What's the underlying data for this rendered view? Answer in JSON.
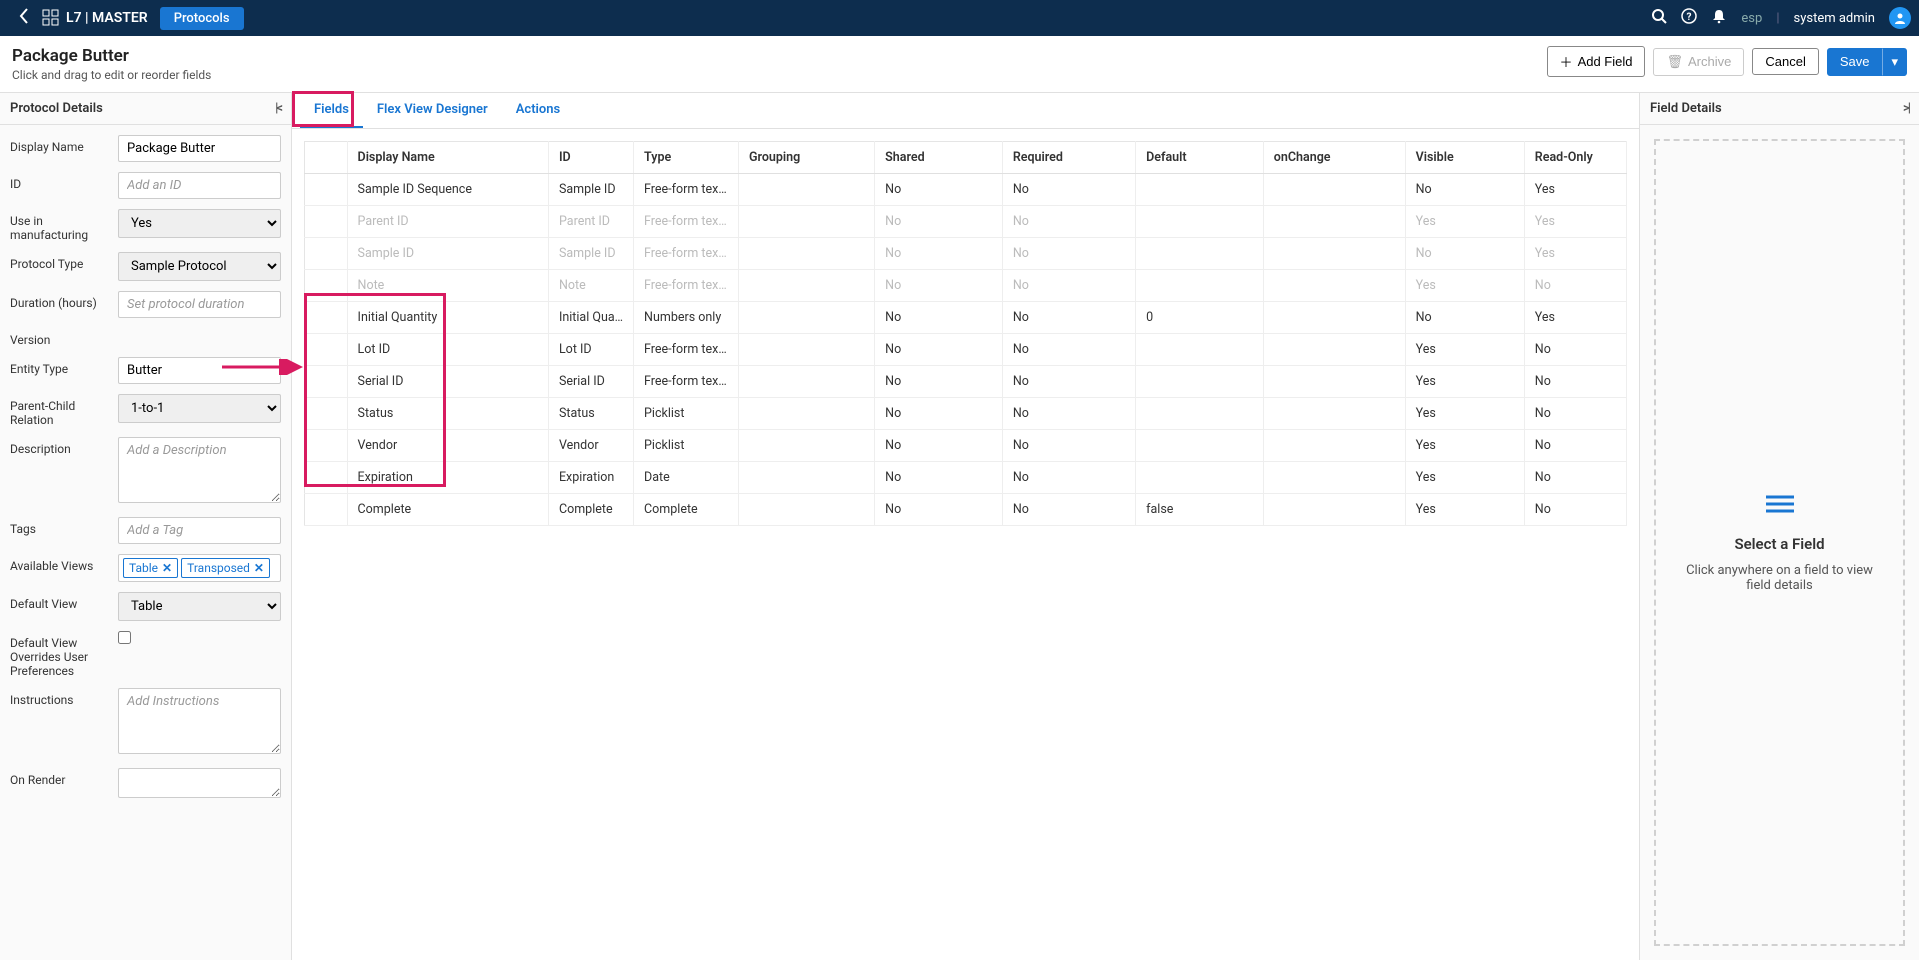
{
  "topnav": {
    "brand": "L7 | MASTER",
    "pill": "Protocols",
    "esp_label": "esp",
    "username": "system admin"
  },
  "header": {
    "title": "Package Butter",
    "subtitle": "Click and drag to edit or reorder fields",
    "add_field": "Add Field",
    "archive": "Archive",
    "cancel": "Cancel",
    "save": "Save"
  },
  "left": {
    "panel_title": "Protocol Details",
    "labels": {
      "display_name": "Display Name",
      "id": "ID",
      "use_mfg": "Use in manufacturing",
      "protocol_type": "Protocol Type",
      "duration": "Duration (hours)",
      "version": "Version",
      "entity_type": "Entity Type",
      "parent_child": "Parent-Child Relation",
      "description": "Description",
      "tags": "Tags",
      "available_views": "Available Views",
      "default_view": "Default View",
      "default_override": "Default View Overrides User Preferences",
      "instructions": "Instructions",
      "on_render": "On Render"
    },
    "values": {
      "display_name": "Package Butter",
      "id_placeholder": "Add an ID",
      "use_mfg": "Yes",
      "protocol_type": "Sample Protocol",
      "duration_placeholder": "Set protocol duration",
      "entity_type": "Butter",
      "parent_child": "1-to-1",
      "description_placeholder": "Add a Description",
      "tags_placeholder": "Add a Tag",
      "chips": [
        "Table",
        "Transposed"
      ],
      "default_view": "Table",
      "instructions_placeholder": "Add Instructions"
    }
  },
  "tabs": {
    "fields": "Fields",
    "flex": "Flex View Designer",
    "actions": "Actions"
  },
  "table": {
    "headers": [
      "",
      "Display Name",
      "ID",
      "Type",
      "Grouping",
      "Shared",
      "Required",
      "Default",
      "onChange",
      "Visible",
      "Read-Only"
    ],
    "rows": [
      {
        "dim": false,
        "name": "Sample ID Sequence",
        "id": "Sample ID",
        "type": "Free-form text entry",
        "grp": "",
        "shared": "No",
        "req": "No",
        "def": "",
        "chg": "",
        "vis": "No",
        "ro": "Yes"
      },
      {
        "dim": true,
        "name": "Parent ID",
        "id": "Parent ID",
        "type": "Free-form text entry",
        "grp": "",
        "shared": "No",
        "req": "No",
        "def": "",
        "chg": "",
        "vis": "Yes",
        "ro": "Yes"
      },
      {
        "dim": true,
        "name": "Sample ID",
        "id": "Sample ID",
        "type": "Free-form text entry",
        "grp": "",
        "shared": "No",
        "req": "No",
        "def": "",
        "chg": "",
        "vis": "No",
        "ro": "Yes"
      },
      {
        "dim": true,
        "name": "Note",
        "id": "Note",
        "type": "Free-form text entry",
        "grp": "",
        "shared": "No",
        "req": "No",
        "def": "",
        "chg": "",
        "vis": "Yes",
        "ro": "No"
      },
      {
        "dim": false,
        "name": "Initial Quantity",
        "id": "Initial Quantity",
        "type": "Numbers only",
        "grp": "",
        "shared": "No",
        "req": "No",
        "def": "0",
        "chg": "",
        "vis": "No",
        "ro": "Yes"
      },
      {
        "dim": false,
        "name": "Lot ID",
        "id": "Lot ID",
        "type": "Free-form text entry",
        "grp": "",
        "shared": "No",
        "req": "No",
        "def": "",
        "chg": "",
        "vis": "Yes",
        "ro": "No"
      },
      {
        "dim": false,
        "name": "Serial ID",
        "id": "Serial ID",
        "type": "Free-form text entry",
        "grp": "",
        "shared": "No",
        "req": "No",
        "def": "",
        "chg": "",
        "vis": "Yes",
        "ro": "No"
      },
      {
        "dim": false,
        "name": "Status",
        "id": "Status",
        "type": "Picklist",
        "grp": "",
        "shared": "No",
        "req": "No",
        "def": "",
        "chg": "",
        "vis": "Yes",
        "ro": "No"
      },
      {
        "dim": false,
        "name": "Vendor",
        "id": "Vendor",
        "type": "Picklist",
        "grp": "",
        "shared": "No",
        "req": "No",
        "def": "",
        "chg": "",
        "vis": "Yes",
        "ro": "No"
      },
      {
        "dim": false,
        "name": "Expiration",
        "id": "Expiration",
        "type": "Date",
        "grp": "",
        "shared": "No",
        "req": "No",
        "def": "",
        "chg": "",
        "vis": "Yes",
        "ro": "No"
      },
      {
        "dim": false,
        "name": "Complete",
        "id": "Complete",
        "type": "Complete",
        "grp": "",
        "shared": "No",
        "req": "No",
        "def": "false",
        "chg": "",
        "vis": "Yes",
        "ro": "No"
      }
    ]
  },
  "right": {
    "panel_title": "Field Details",
    "empty_title": "Select a Field",
    "empty_text": "Click anywhere on a field to view field details"
  }
}
